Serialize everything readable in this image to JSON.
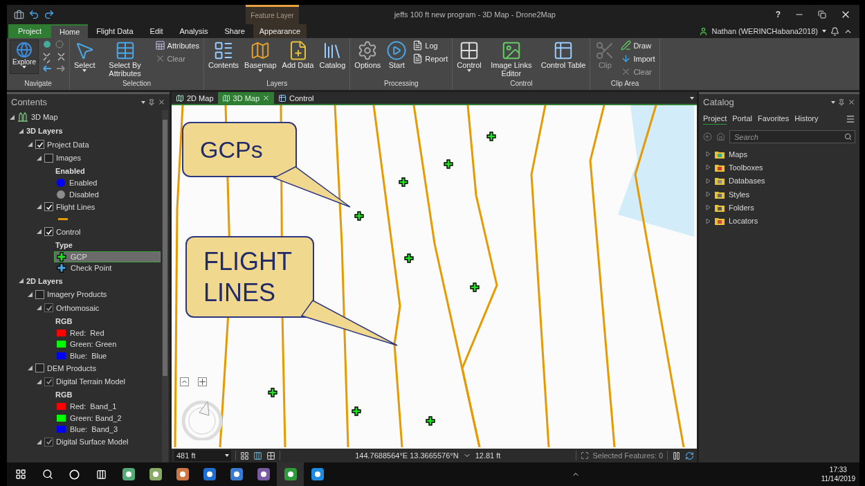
{
  "title_bar": {
    "title": "jeffs 100 ft new program - 3D Map - Drone2Map",
    "context_group": "Feature Layer",
    "help": "?"
  },
  "ribbon_tabs": [
    {
      "label": "Project",
      "kind": "file",
      "selected": false
    },
    {
      "label": "Home",
      "kind": "normal",
      "selected": true
    },
    {
      "label": "Flight Data",
      "kind": "normal",
      "selected": false
    },
    {
      "label": "Edit",
      "kind": "normal",
      "selected": false
    },
    {
      "label": "Analysis",
      "kind": "normal",
      "selected": false
    },
    {
      "label": "Share",
      "kind": "normal",
      "selected": false
    },
    {
      "label": "Appearance",
      "kind": "contextual",
      "selected": false
    }
  ],
  "user": {
    "name": "Nathan (WERINCHabana2018)"
  },
  "ribbon_groups": [
    {
      "title": "Navigate",
      "tools": [
        {
          "label": "Explore",
          "kind": "nav",
          "menu": true,
          "disabled": false
        }
      ]
    },
    {
      "title": "Selection",
      "tools": [
        {
          "label": "Select",
          "kind": "large",
          "menu": true,
          "disabled": false
        },
        {
          "label": "Select By Attributes",
          "kind": "large",
          "menu": false,
          "disabled": false
        },
        {
          "label": "Attributes",
          "kind": "small",
          "menu": false,
          "disabled": false
        },
        {
          "label": "Clear",
          "kind": "small",
          "menu": false,
          "disabled": true
        }
      ]
    },
    {
      "title": "Layers",
      "tools": [
        {
          "label": "Contents",
          "kind": "large",
          "menu": false,
          "disabled": false
        },
        {
          "label": "Basemap",
          "kind": "large",
          "menu": true,
          "disabled": false
        },
        {
          "label": "Add Data",
          "kind": "large",
          "menu": false,
          "disabled": false
        },
        {
          "label": "Catalog",
          "kind": "large",
          "menu": false,
          "disabled": false
        }
      ]
    },
    {
      "title": "Processing",
      "tools": [
        {
          "label": "Options",
          "kind": "large",
          "menu": false,
          "disabled": false
        },
        {
          "label": "Start",
          "kind": "large",
          "menu": false,
          "disabled": false
        },
        {
          "label": "Log",
          "kind": "small",
          "menu": false,
          "disabled": false
        },
        {
          "label": "Report",
          "kind": "small",
          "menu": false,
          "disabled": false
        }
      ]
    },
    {
      "title": "Control",
      "tools": [
        {
          "label": "Control",
          "kind": "large",
          "menu": true,
          "disabled": false
        },
        {
          "label": "Image Links Editor",
          "kind": "large",
          "menu": false,
          "disabled": false
        },
        {
          "label": "Control Table",
          "kind": "large",
          "menu": false,
          "disabled": false
        }
      ]
    },
    {
      "title": "Clip Area",
      "tools": [
        {
          "label": "Clip",
          "kind": "large",
          "menu": false,
          "disabled": true
        },
        {
          "label": "Draw",
          "kind": "small",
          "menu": false,
          "disabled": false
        },
        {
          "label": "Import",
          "kind": "small",
          "menu": false,
          "disabled": false
        },
        {
          "label": "Clear",
          "kind": "small",
          "menu": false,
          "disabled": true
        }
      ]
    }
  ],
  "contents": {
    "title": "Contents",
    "tree": [
      {
        "kind": "map",
        "label": "3D Map",
        "expanded": true,
        "children": [
          {
            "kind": "group",
            "label": "3D Layers",
            "expanded": true,
            "children": [
              {
                "kind": "layer",
                "label": "Project Data",
                "expanded": true,
                "checked": true,
                "disabled": false,
                "children": [
                  {
                    "kind": "layer",
                    "label": "Images",
                    "expanded": true,
                    "checked": false,
                    "disabled": false,
                    "children": [
                      {
                        "kind": "heading",
                        "label": "Enabled"
                      },
                      {
                        "kind": "dot",
                        "label": "Enabled",
                        "color": "#0000ff",
                        "selected": false
                      },
                      {
                        "kind": "dot",
                        "label": "Disabled",
                        "color": "#8c8c8c",
                        "selected": false
                      }
                    ]
                  },
                  {
                    "kind": "layer",
                    "label": "Flight Lines",
                    "expanded": true,
                    "checked": true,
                    "disabled": false,
                    "children": [
                      {
                        "kind": "line",
                        "color": "#e69a00",
                        "selected": false
                      }
                    ]
                  },
                  {
                    "kind": "layer",
                    "label": "Control",
                    "expanded": true,
                    "checked": true,
                    "disabled": false,
                    "children": [
                      {
                        "kind": "heading",
                        "label": "Type"
                      },
                      {
                        "kind": "cross",
                        "label": "GCP",
                        "color": "#22e022",
                        "selected": true
                      },
                      {
                        "kind": "cross",
                        "label": "Check Point",
                        "color": "#4aa8e8",
                        "selected": false
                      }
                    ]
                  }
                ]
              }
            ]
          },
          {
            "kind": "group",
            "label": "2D Layers",
            "expanded": true,
            "children": [
              {
                "kind": "layer",
                "label": "Imagery Products",
                "expanded": true,
                "checked": false,
                "disabled": false,
                "children": [
                  {
                    "kind": "layer",
                    "label": "Orthomosaic",
                    "expanded": true,
                    "checked": true,
                    "disabled": true,
                    "children": [
                      {
                        "kind": "heading",
                        "label": "RGB"
                      },
                      {
                        "kind": "swatch",
                        "label": "Red:  Red",
                        "color": "#ff0000",
                        "selected": false
                      },
                      {
                        "kind": "swatch",
                        "label": "Green: Green",
                        "color": "#00ff00",
                        "selected": false
                      },
                      {
                        "kind": "swatch",
                        "label": "Blue:  Blue",
                        "color": "#0000ff",
                        "selected": false
                      }
                    ]
                  }
                ]
              },
              {
                "kind": "layer",
                "label": "DEM Products",
                "expanded": true,
                "checked": false,
                "disabled": false,
                "children": [
                  {
                    "kind": "layer",
                    "label": "Digital Terrain Model",
                    "expanded": true,
                    "checked": true,
                    "disabled": true,
                    "children": [
                      {
                        "kind": "heading",
                        "label": "RGB"
                      },
                      {
                        "kind": "swatch",
                        "label": "Red:  Band_1",
                        "color": "#ff0000",
                        "selected": false
                      },
                      {
                        "kind": "swatch",
                        "label": "Green: Band_2",
                        "color": "#00ff00",
                        "selected": false
                      },
                      {
                        "kind": "swatch",
                        "label": "Blue:  Band_3",
                        "color": "#0000ff",
                        "selected": false
                      }
                    ]
                  },
                  {
                    "kind": "layer",
                    "label": "Digital Surface Model",
                    "expanded": true,
                    "checked": true,
                    "disabled": true
                  }
                ]
              }
            ]
          }
        ]
      }
    ]
  },
  "view_tabs": [
    {
      "label": "2D Map",
      "selected": false
    },
    {
      "label": "3D Map",
      "selected": true
    },
    {
      "label": "Control",
      "selected": false
    }
  ],
  "map": {
    "callouts": [
      {
        "text": "GCPs"
      },
      {
        "text": "FLIGHT LINES"
      }
    ]
  },
  "status_bar": {
    "scale": "481 ft",
    "coordinates": "144.7688564°E 13.3665576°N",
    "elevation": "12.81 ft",
    "selected_features": "Selected Features: 0"
  },
  "catalog": {
    "title": "Catalog",
    "tabs": [
      {
        "label": "Project",
        "selected": true
      },
      {
        "label": "Portal",
        "selected": false
      },
      {
        "label": "Favorites",
        "selected": false
      },
      {
        "label": "History",
        "selected": false
      }
    ],
    "search": {
      "placeholder": "Search"
    },
    "items": [
      {
        "label": "Maps",
        "expanded": false
      },
      {
        "label": "Toolboxes",
        "expanded": false
      },
      {
        "label": "Databases",
        "expanded": false
      },
      {
        "label": "Styles",
        "expanded": false
      },
      {
        "label": "Folders",
        "expanded": false
      },
      {
        "label": "Locators",
        "expanded": false
      }
    ]
  },
  "taskbar": {
    "time": "17:33",
    "date": "11/14/2019"
  }
}
